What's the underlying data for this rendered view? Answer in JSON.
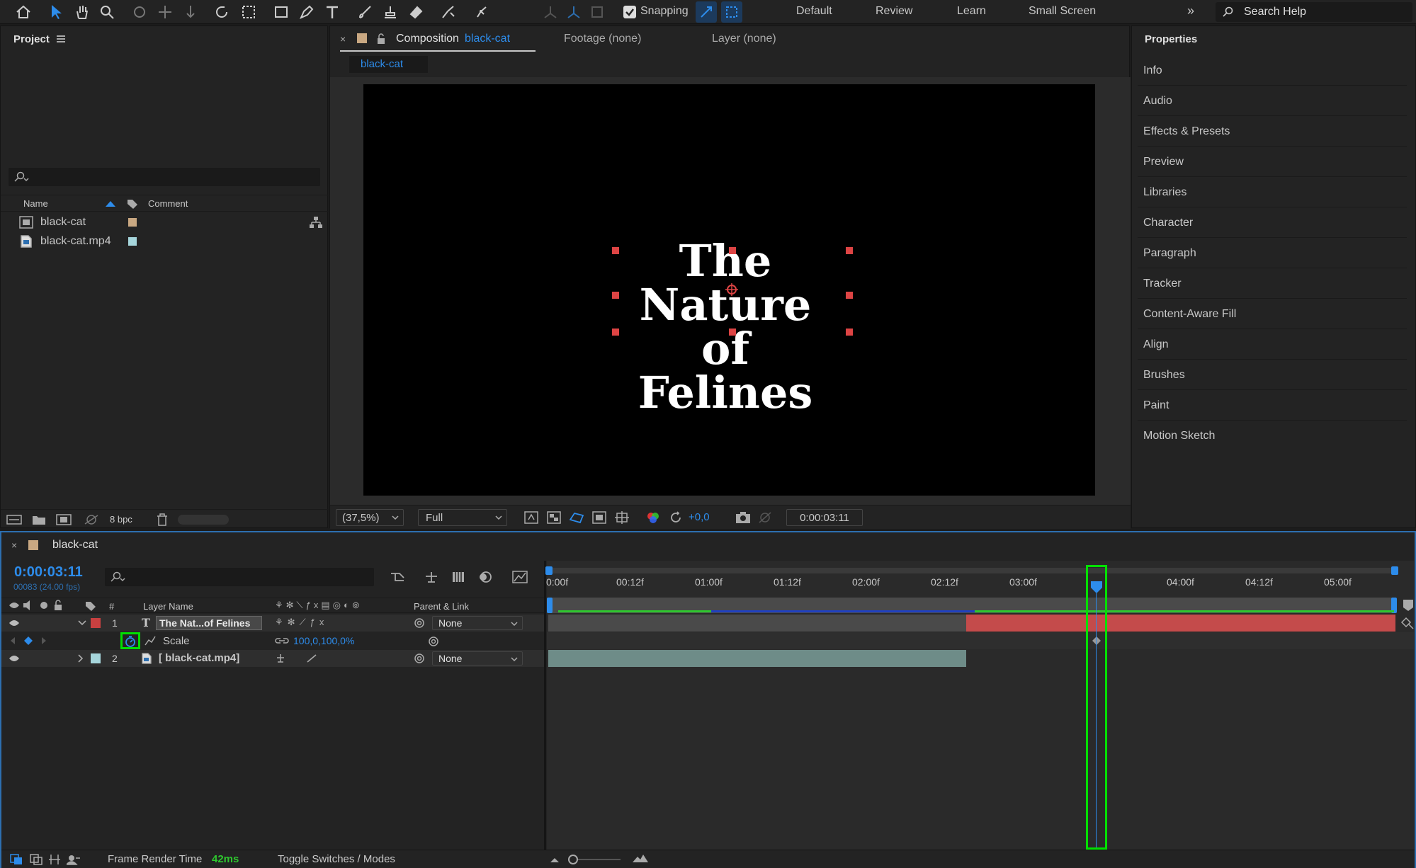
{
  "toolbar": {
    "snapping_label": "Snapping",
    "workspaces": [
      "Default",
      "Review",
      "Learn",
      "Small Screen"
    ],
    "search_placeholder": "Search Help"
  },
  "project": {
    "title": "Project",
    "col_name": "Name",
    "col_comment": "Comment",
    "items": [
      {
        "name": "black-cat",
        "label_color": "#c9a882",
        "icon": "composition-icon"
      },
      {
        "name": "black-cat.mp4",
        "label_color": "#a6d6dc",
        "icon": "footage-icon"
      }
    ],
    "bpc": "8 bpc"
  },
  "viewer": {
    "tab_composition": "Composition",
    "comp_name": "black-cat",
    "tab_footage": "Footage (none)",
    "tab_layer": "Layer (none)",
    "subtab": "black-cat",
    "title_line1": "The Nature",
    "title_line2": "of Felines",
    "zoom": "(37,5%)",
    "resolution": "Full",
    "exposure": "+0,0",
    "timecode": "0:00:03:11"
  },
  "properties": {
    "title": "Properties",
    "items": [
      "Info",
      "Audio",
      "Effects & Presets",
      "Preview",
      "Libraries",
      "Character",
      "Paragraph",
      "Tracker",
      "Content-Aware Fill",
      "Align",
      "Brushes",
      "Paint",
      "Motion Sketch"
    ]
  },
  "timeline": {
    "comp_name": "black-cat",
    "timecode": "0:00:03:11",
    "frame_info": "00083 (24.00 fps)",
    "col_num": "#",
    "col_layer_name": "Layer Name",
    "col_parent": "Parent & Link",
    "layers": [
      {
        "num": "1",
        "name": "The Nat...of Felines",
        "parent": "None",
        "label_color": "#c84040"
      },
      {
        "num": "2",
        "name": "[ black-cat.mp4]",
        "parent": "None",
        "label_color": "#a6d6dc"
      }
    ],
    "scale_label": "Scale",
    "scale_value": "100,0,100,0%",
    "ticks": [
      "0:00f",
      "00:12f",
      "01:00f",
      "01:12f",
      "02:00f",
      "02:12f",
      "03:00f",
      "03:12f",
      "04:00f",
      "04:12f",
      "05:00f"
    ],
    "status_label": "Frame Render Time",
    "status_value": "42ms",
    "toggle_label": "Toggle Switches / Modes"
  },
  "colors": {
    "accent": "#2d8ceb",
    "highlight": "#00e000",
    "layer1_bar": "#c44b4b",
    "layer2_bar": "#6e8c88"
  }
}
